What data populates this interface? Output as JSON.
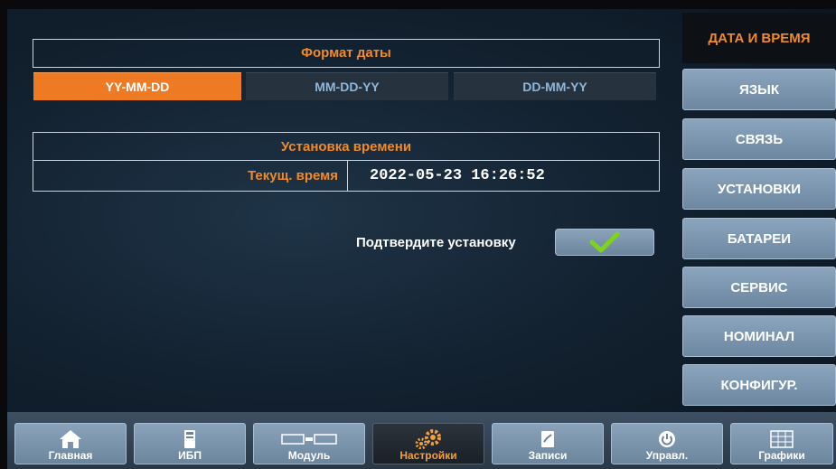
{
  "date_format": {
    "title": "Формат даты",
    "options": [
      "YY-MM-DD",
      "MM-DD-YY",
      "DD-MM-YY"
    ],
    "selected": "YY-MM-DD"
  },
  "time_setting": {
    "title": "Установка времени",
    "current_label": "Текущ. время",
    "current_value": "2022-05-23 16:26:52"
  },
  "confirm": {
    "label": "Подтвердите установку",
    "icon": "checkmark-icon"
  },
  "sidebar": {
    "active": "ДАТА И ВРЕМЯ",
    "items": [
      "ЯЗЫК",
      "СВЯЗЬ",
      "УСТАНОВКИ",
      "БАТАРЕИ",
      "СЕРВИС",
      "НОМИНАЛ",
      "КОНФИГУР."
    ]
  },
  "bottom_nav": [
    {
      "label": "Главная",
      "icon": "home-icon"
    },
    {
      "label": "ИБП",
      "icon": "ups-icon"
    },
    {
      "label": "Модуль",
      "icon": "module-icon"
    },
    {
      "label": "Настройки",
      "icon": "gears-icon",
      "active": true
    },
    {
      "label": "Записи",
      "icon": "records-icon"
    },
    {
      "label": "Управл.",
      "icon": "power-icon"
    },
    {
      "label": "Графики",
      "icon": "grid-icon"
    }
  ],
  "colors": {
    "accent": "#f08a2a",
    "selected": "#ef7a24",
    "check": "#7ed321"
  }
}
